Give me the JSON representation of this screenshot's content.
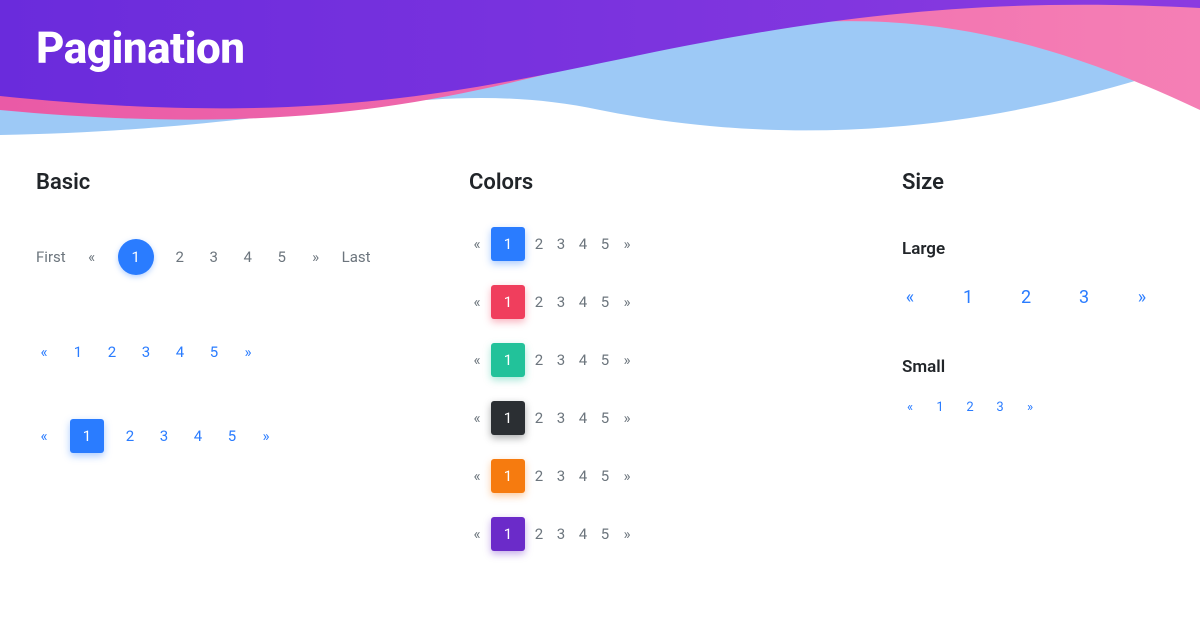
{
  "hero": {
    "title": "Pagination"
  },
  "sections": {
    "basic": {
      "title": "Basic",
      "row1": {
        "first": "First",
        "prev": "«",
        "active": "1",
        "pages": [
          "2",
          "3",
          "4",
          "5"
        ],
        "next": "»",
        "last": "Last"
      },
      "row2": {
        "prev": "«",
        "pages": [
          "1",
          "2",
          "3",
          "4",
          "5"
        ],
        "next": "»"
      },
      "row3": {
        "prev": "«",
        "active": "1",
        "pages": [
          "2",
          "3",
          "4",
          "5"
        ],
        "next": "»"
      }
    },
    "colors": {
      "title": "Colors",
      "rows": [
        {
          "active": "1",
          "pages": [
            "2",
            "3",
            "4",
            "5"
          ],
          "color": "primary"
        },
        {
          "active": "1",
          "pages": [
            "2",
            "3",
            "4",
            "5"
          ],
          "color": "danger"
        },
        {
          "active": "1",
          "pages": [
            "2",
            "3",
            "4",
            "5"
          ],
          "color": "teal"
        },
        {
          "active": "1",
          "pages": [
            "2",
            "3",
            "4",
            "5"
          ],
          "color": "dark"
        },
        {
          "active": "1",
          "pages": [
            "2",
            "3",
            "4",
            "5"
          ],
          "color": "orange"
        },
        {
          "active": "1",
          "pages": [
            "2",
            "3",
            "4",
            "5"
          ],
          "color": "purple"
        }
      ],
      "prev": "«",
      "next": "»"
    },
    "size": {
      "title": "Size",
      "large": {
        "label": "Large",
        "prev": "«",
        "pages": [
          "1",
          "2",
          "3"
        ],
        "next": "»"
      },
      "small": {
        "label": "Small",
        "prev": "«",
        "pages": [
          "1",
          "2",
          "3"
        ],
        "next": "»"
      }
    }
  }
}
